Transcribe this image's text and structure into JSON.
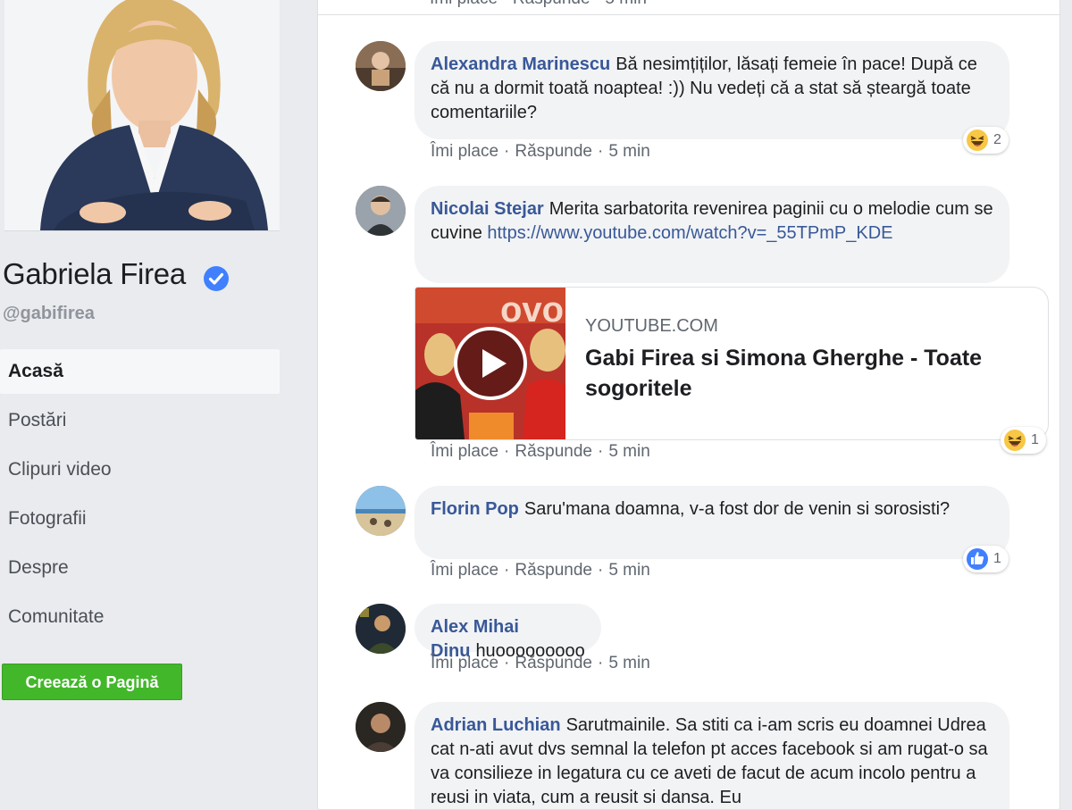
{
  "profile": {
    "name": "Gabriela Firea",
    "handle": "@gabifirea"
  },
  "nav": {
    "items": [
      {
        "label": "Acasă",
        "active": true
      },
      {
        "label": "Postări"
      },
      {
        "label": "Clipuri video"
      },
      {
        "label": "Fotografii"
      },
      {
        "label": "Despre"
      },
      {
        "label": "Comunitate"
      }
    ],
    "create_page": "Creează o Pagină"
  },
  "actions": {
    "like": "Îmi place",
    "reply": "Răspunde",
    "separator": "·"
  },
  "top_strip": {
    "partial_actions": "Îmi place · Răspunde · 5 min"
  },
  "comments": [
    {
      "author": "Alexandra Marinescu",
      "text": "Bă nesimțiților, lăsați femeie în pace! După ce că nu a dormit toată noaptea! :)) Nu vedeți că a stat să șteargă toate comentariile?",
      "time": "5 min",
      "reaction": {
        "icon": "haha-icon",
        "count": "2"
      }
    },
    {
      "author": "Nicolai Stejar",
      "text": "Merita sarbatorita revenirea paginii cu o melodie cum se cuvine",
      "link": "https://www.youtube.com/watch?v=_55TPmP_KDE",
      "time": "5 min",
      "reaction": {
        "icon": "haha-icon",
        "count": "1"
      },
      "preview": {
        "domain": "YOUTUBE.COM",
        "title": "Gabi Firea si Simona Gherghe - Toate sogoritele"
      }
    },
    {
      "author": "Florin Pop",
      "text": "Saru'mana doamna, v-a fost dor de venin si sorosisti?",
      "time": "5 min",
      "reaction": {
        "icon": "like-icon",
        "count": "1"
      }
    },
    {
      "author": "Alex Mihai Dinu",
      "text": "huooooooooo",
      "time": "5 min"
    },
    {
      "author": "Adrian Luchian",
      "text": "Sarutmainile. Sa stiti ca i-am scris eu doamnei Udrea cat n-ati avut dvs semnal la telefon pt acces facebook si am rugat-o sa va consilieze in legatura cu ce aveti de facut de acum incolo pentru a reusi in viata, cum a reusit si dansa. Eu"
    }
  ],
  "colors": {
    "background": "#e9ebee",
    "link": "#385898",
    "bubble": "#f2f3f5",
    "create_button": "#42b72a",
    "verified": "#4080ff"
  }
}
